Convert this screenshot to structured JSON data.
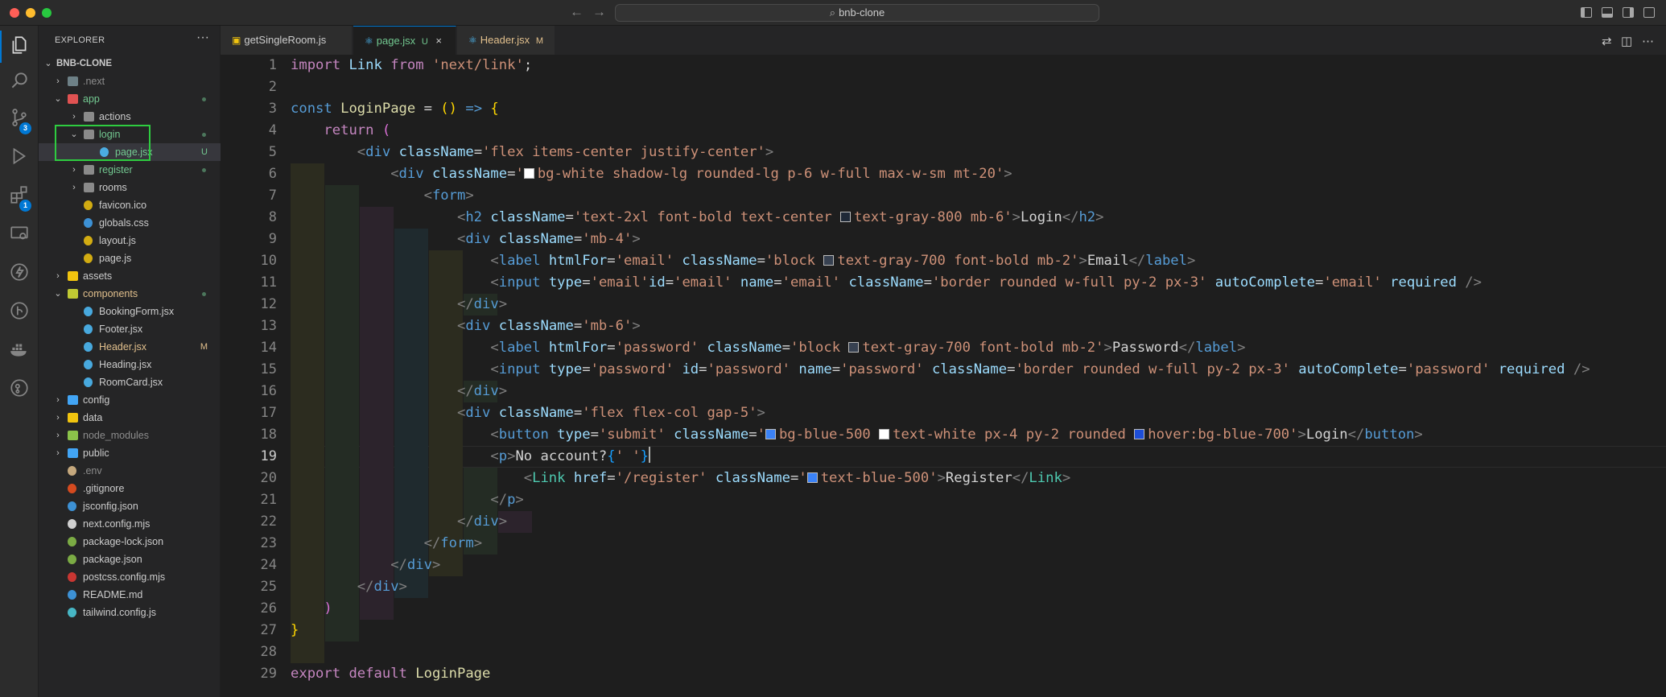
{
  "titlebar": {
    "search_text": "bnb-clone",
    "back_icon": "arrow-left-icon",
    "forward_icon": "arrow-right-icon"
  },
  "activity_bar": {
    "items": [
      {
        "name": "explorer",
        "icon": "files-icon",
        "active": true
      },
      {
        "name": "search",
        "icon": "search-icon"
      },
      {
        "name": "source-control",
        "icon": "source-control-icon",
        "badge": "3"
      },
      {
        "name": "run-debug",
        "icon": "debug-icon"
      },
      {
        "name": "extensions",
        "icon": "extensions-icon",
        "badge": "1"
      },
      {
        "name": "remote",
        "icon": "remote-explorer-icon"
      },
      {
        "name": "thunder",
        "icon": "lightning-icon"
      },
      {
        "name": "git-graph",
        "icon": "git-graph-icon"
      },
      {
        "name": "docker",
        "icon": "docker-icon"
      },
      {
        "name": "gitlens",
        "icon": "gitlens-icon"
      }
    ]
  },
  "explorer": {
    "title": "EXPLORER",
    "more": "···",
    "root": "BNB-CLONE",
    "tree": [
      {
        "label": ".next",
        "depth": 1,
        "type": "folder",
        "expanded": false,
        "color": "#8c8c8c",
        "icon_color": "#6d8086"
      },
      {
        "label": "app",
        "depth": 1,
        "type": "folder",
        "expanded": true,
        "color": "#73c991",
        "icon_color": "#e05252",
        "dot": true
      },
      {
        "label": "actions",
        "depth": 2,
        "type": "folder",
        "expanded": false,
        "color": "#cccccc",
        "icon_color": "#8a8a8a"
      },
      {
        "label": "login",
        "depth": 2,
        "type": "folder",
        "expanded": true,
        "color": "#73c991",
        "icon_color": "#8a8a8a",
        "dot": true
      },
      {
        "label": "page.jsx",
        "depth": 3,
        "type": "file",
        "color": "#73c991",
        "icon_color": "#4fc1ff",
        "deco": "U",
        "selected": true
      },
      {
        "label": "register",
        "depth": 2,
        "type": "folder",
        "expanded": false,
        "color": "#73c991",
        "icon_color": "#8a8a8a",
        "dot": true
      },
      {
        "label": "rooms",
        "depth": 2,
        "type": "folder",
        "expanded": false,
        "color": "#cccccc",
        "icon_color": "#8a8a8a"
      },
      {
        "label": "favicon.ico",
        "depth": 2,
        "type": "file",
        "color": "#cccccc",
        "icon_color": "#f1c40f"
      },
      {
        "label": "globals.css",
        "depth": 2,
        "type": "file",
        "color": "#cccccc",
        "icon_color": "#42a5f5"
      },
      {
        "label": "layout.js",
        "depth": 2,
        "type": "file",
        "color": "#cccccc",
        "icon_color": "#f1c40f"
      },
      {
        "label": "page.js",
        "depth": 2,
        "type": "file",
        "color": "#cccccc",
        "icon_color": "#f1c40f"
      },
      {
        "label": "assets",
        "depth": 1,
        "type": "folder",
        "expanded": false,
        "color": "#cccccc",
        "icon_color": "#f1c40f"
      },
      {
        "label": "components",
        "depth": 1,
        "type": "folder",
        "expanded": true,
        "color": "#e2c08d",
        "icon_color": "#c0ca33",
        "dot": true
      },
      {
        "label": "BookingForm.jsx",
        "depth": 2,
        "type": "file",
        "color": "#cccccc",
        "icon_color": "#4fc1ff"
      },
      {
        "label": "Footer.jsx",
        "depth": 2,
        "type": "file",
        "color": "#cccccc",
        "icon_color": "#4fc1ff"
      },
      {
        "label": "Header.jsx",
        "depth": 2,
        "type": "file",
        "color": "#e2c08d",
        "icon_color": "#4fc1ff",
        "deco": "M"
      },
      {
        "label": "Heading.jsx",
        "depth": 2,
        "type": "file",
        "color": "#cccccc",
        "icon_color": "#4fc1ff"
      },
      {
        "label": "RoomCard.jsx",
        "depth": 2,
        "type": "file",
        "color": "#cccccc",
        "icon_color": "#4fc1ff"
      },
      {
        "label": "config",
        "depth": 1,
        "type": "folder",
        "expanded": false,
        "color": "#cccccc",
        "icon_color": "#42a5f5"
      },
      {
        "label": "data",
        "depth": 1,
        "type": "folder",
        "expanded": false,
        "color": "#cccccc",
        "icon_color": "#f1c40f"
      },
      {
        "label": "node_modules",
        "depth": 1,
        "type": "folder",
        "expanded": false,
        "color": "#8c8c8c",
        "icon_color": "#8bc34a"
      },
      {
        "label": "public",
        "depth": 1,
        "type": "folder",
        "expanded": false,
        "color": "#cccccc",
        "icon_color": "#42a5f5"
      },
      {
        "label": ".env",
        "depth": 1,
        "type": "file",
        "color": "#8c8c8c",
        "icon_color": "#e2c08d"
      },
      {
        "label": ".gitignore",
        "depth": 1,
        "type": "file",
        "color": "#cccccc",
        "icon_color": "#f4511e"
      },
      {
        "label": "jsconfig.json",
        "depth": 1,
        "type": "file",
        "color": "#cccccc",
        "icon_color": "#42a5f5"
      },
      {
        "label": "next.config.mjs",
        "depth": 1,
        "type": "file",
        "color": "#cccccc",
        "icon_color": "#eeeeee"
      },
      {
        "label": "package-lock.json",
        "depth": 1,
        "type": "file",
        "color": "#cccccc",
        "icon_color": "#8bc34a"
      },
      {
        "label": "package.json",
        "depth": 1,
        "type": "file",
        "color": "#cccccc",
        "icon_color": "#8bc34a"
      },
      {
        "label": "postcss.config.mjs",
        "depth": 1,
        "type": "file",
        "color": "#cccccc",
        "icon_color": "#e53935"
      },
      {
        "label": "README.md",
        "depth": 1,
        "type": "file",
        "color": "#cccccc",
        "icon_color": "#42a5f5"
      },
      {
        "label": "tailwind.config.js",
        "depth": 1,
        "type": "file",
        "color": "#cccccc",
        "icon_color": "#4dd0e1"
      }
    ]
  },
  "tabs": [
    {
      "label": "getSingleRoom.js",
      "icon": "js-file-icon",
      "color": "#cccccc",
      "icon_color": "#f1c40f",
      "deco": ""
    },
    {
      "label": "page.jsx",
      "icon": "react-file-icon",
      "color": "#73c991",
      "icon_color": "#4fc1ff",
      "deco": "U",
      "active": true,
      "close": "×"
    },
    {
      "label": "Header.jsx",
      "icon": "react-file-icon",
      "color": "#e2c08d",
      "icon_color": "#4fc1ff",
      "deco": "M"
    }
  ],
  "editor": {
    "current_line": 19,
    "line_numbers": [
      "1",
      "2",
      "3",
      "4",
      "5",
      "6",
      "7",
      "8",
      "9",
      "10",
      "11",
      "12",
      "13",
      "14",
      "15",
      "16",
      "17",
      "18",
      "19",
      "20",
      "21",
      "22",
      "23",
      "24",
      "25",
      "26",
      "27",
      "28",
      "29"
    ]
  },
  "colors": {
    "accent": "#0078d4",
    "untracked": "#73c991",
    "modified": "#e2c08d",
    "highlight_box": "#2ecc40"
  }
}
